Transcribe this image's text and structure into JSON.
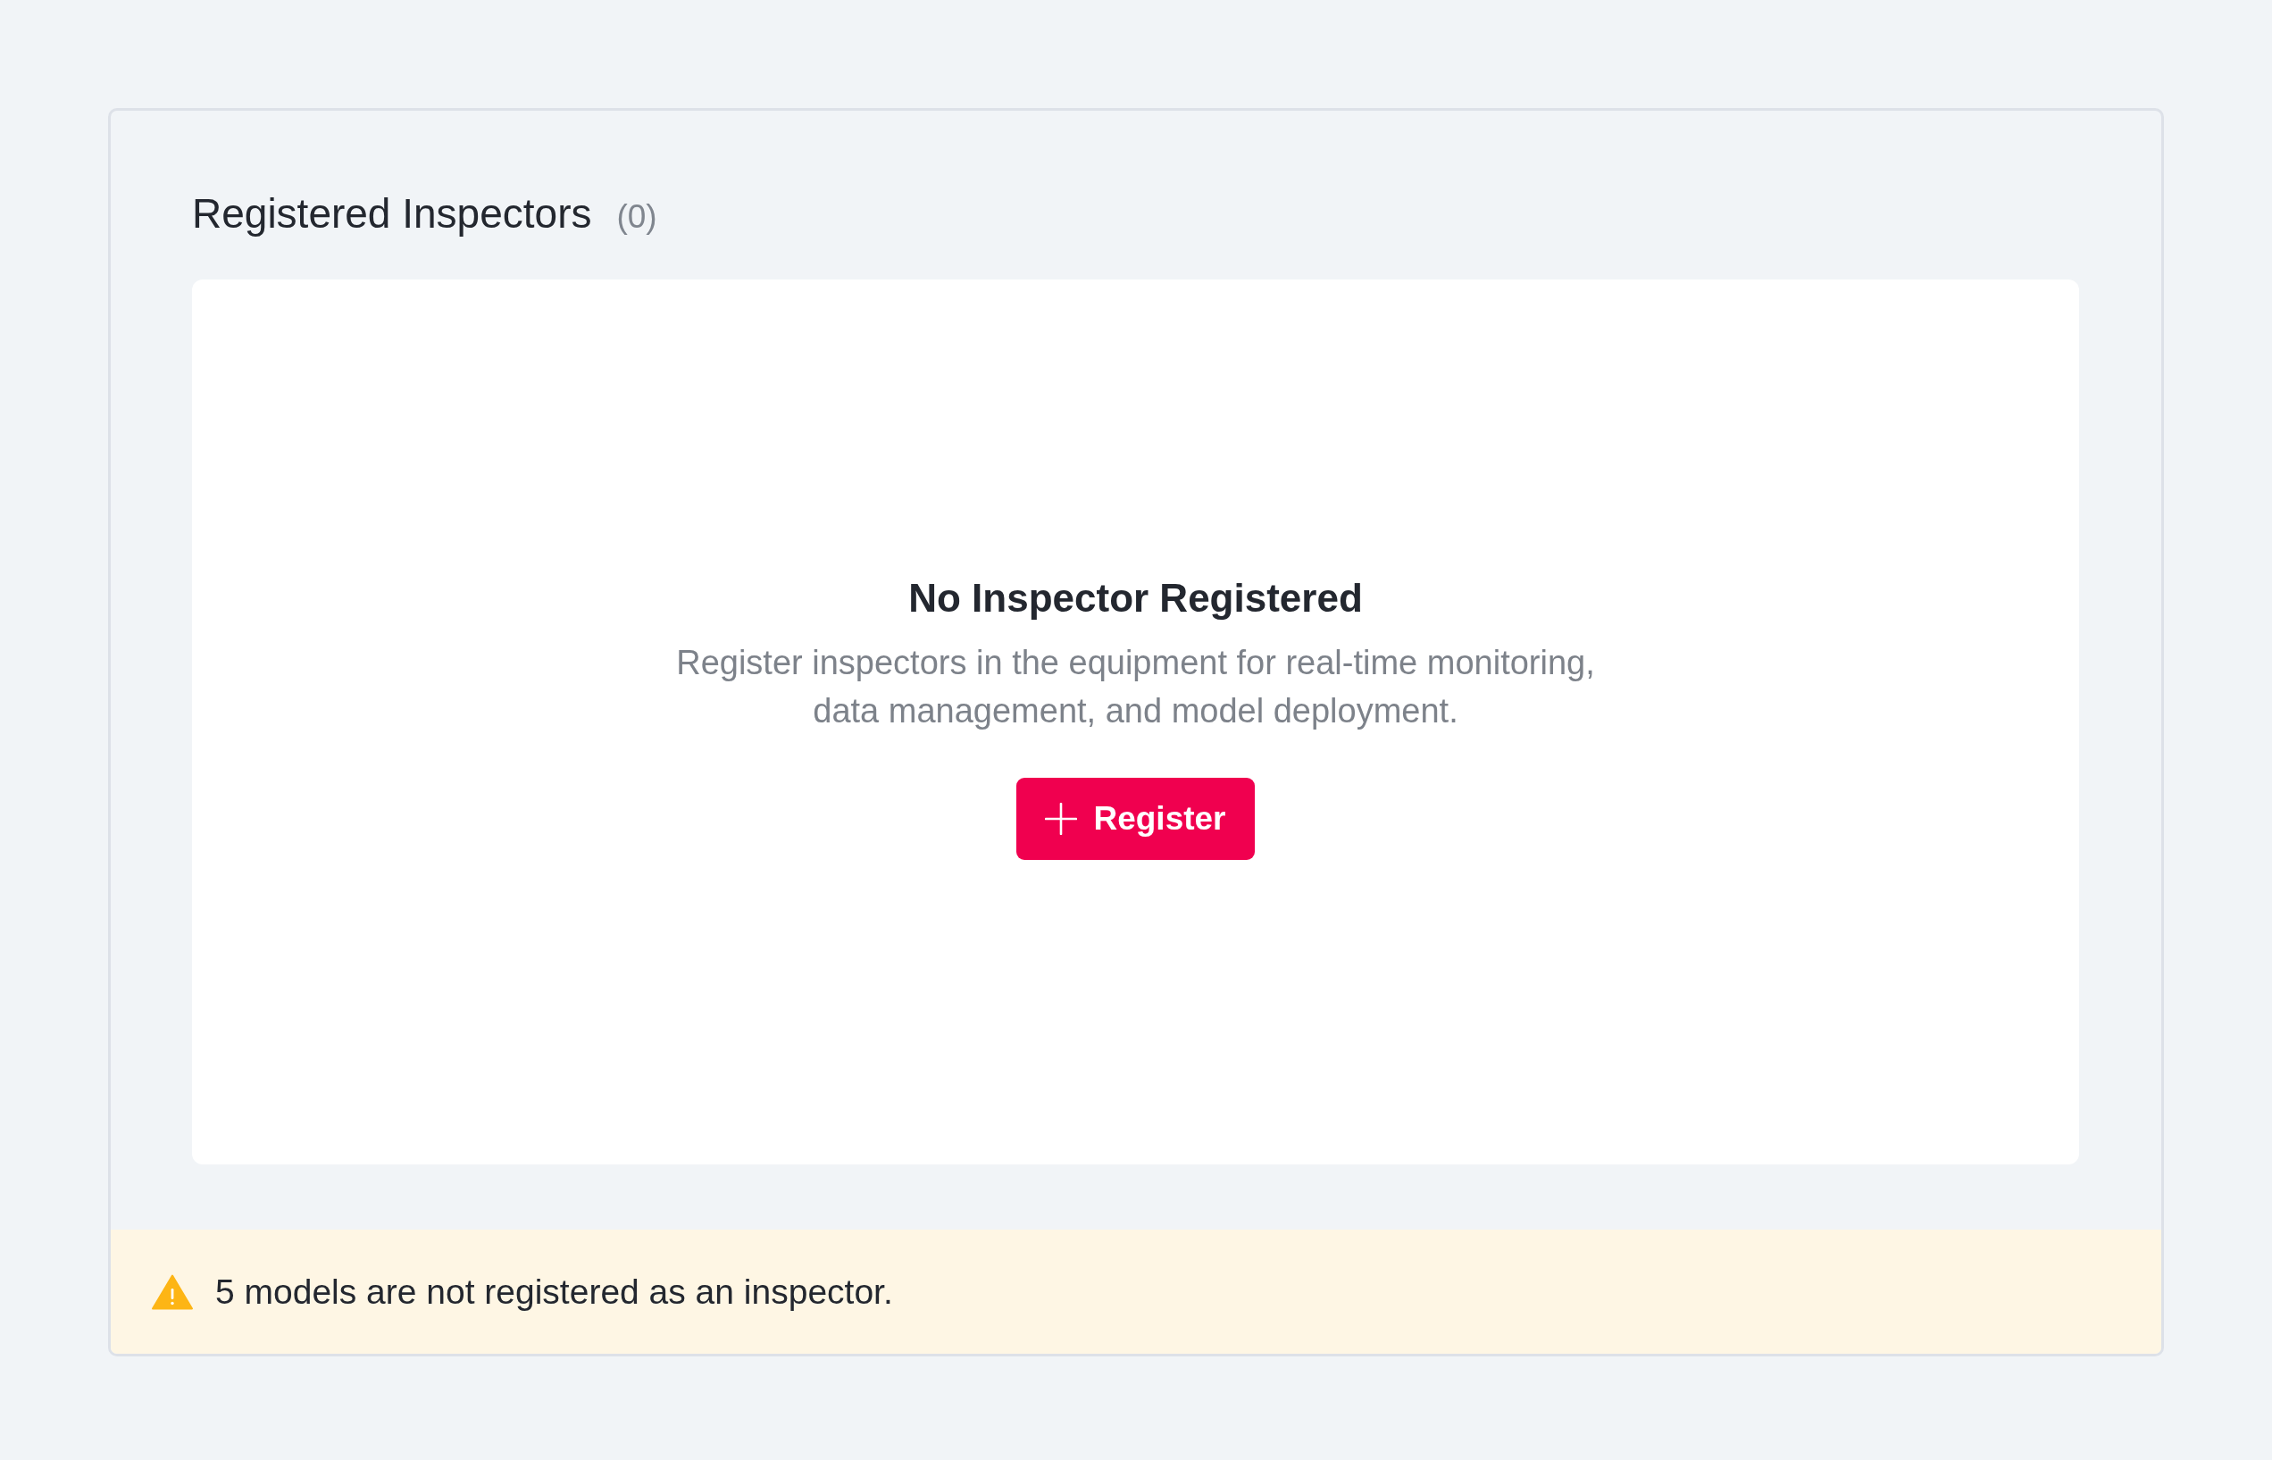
{
  "section": {
    "title": "Registered Inspectors",
    "count": "(0)"
  },
  "empty_state": {
    "title": "No Inspector Registered",
    "description": "Register inspectors in the equipment for real-time monitoring, data management, and model deployment.",
    "button": {
      "label": "Register"
    }
  },
  "warning": {
    "message": "5 models are not registered as an inspector."
  }
}
